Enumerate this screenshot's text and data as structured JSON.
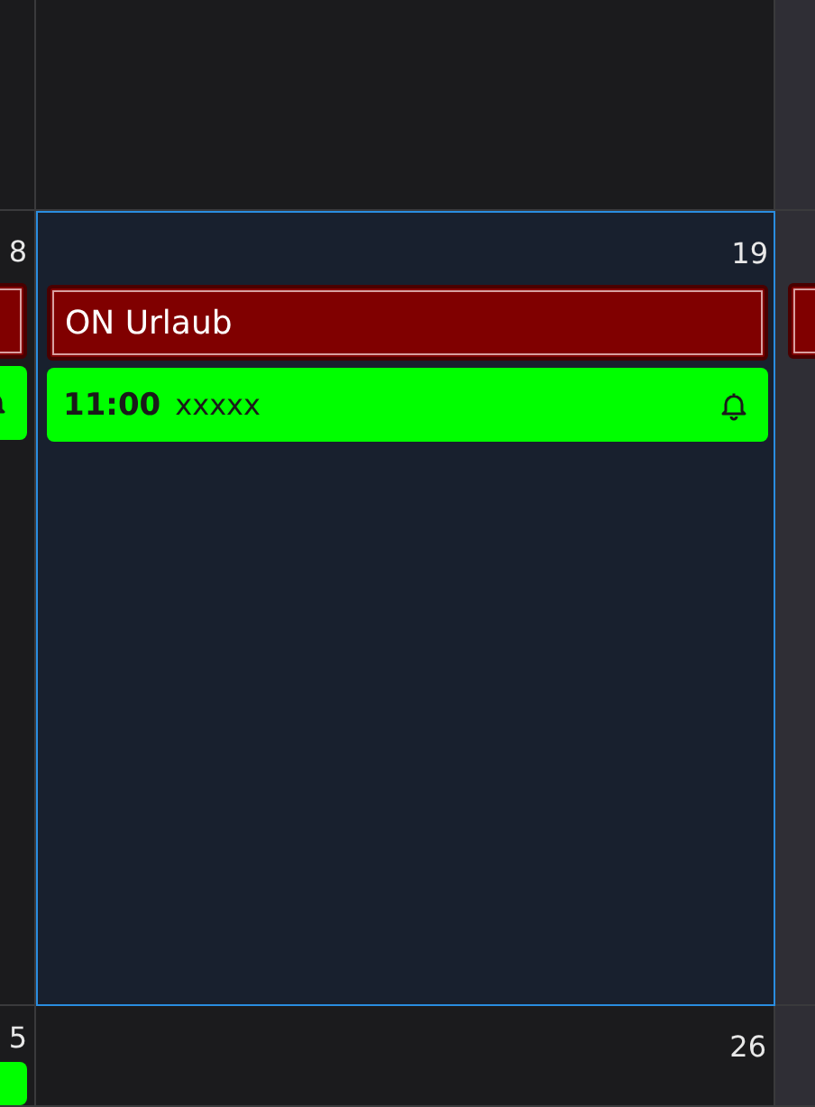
{
  "weeks": [
    {
      "days": [
        {
          "selected": false
        },
        {
          "selected": false
        },
        {
          "selected": false
        }
      ]
    },
    {
      "days": [
        {
          "number": "8",
          "selected": false,
          "events": [
            {
              "kind": "all_day"
            },
            {
              "kind": "timed",
              "reminder": true
            }
          ]
        },
        {
          "number": "19",
          "selected": true,
          "events": [
            {
              "kind": "all_day",
              "title": "ON Urlaub"
            },
            {
              "kind": "timed",
              "time": "11:00",
              "title": "xxxxx",
              "reminder": true
            }
          ]
        },
        {
          "selected": false,
          "events": [
            {
              "kind": "all_day"
            }
          ]
        }
      ]
    },
    {
      "days": [
        {
          "number": "5",
          "selected": false,
          "events": [
            {
              "kind": "timed"
            }
          ]
        },
        {
          "number": "26",
          "selected": false
        },
        {
          "selected": false
        }
      ]
    }
  ]
}
